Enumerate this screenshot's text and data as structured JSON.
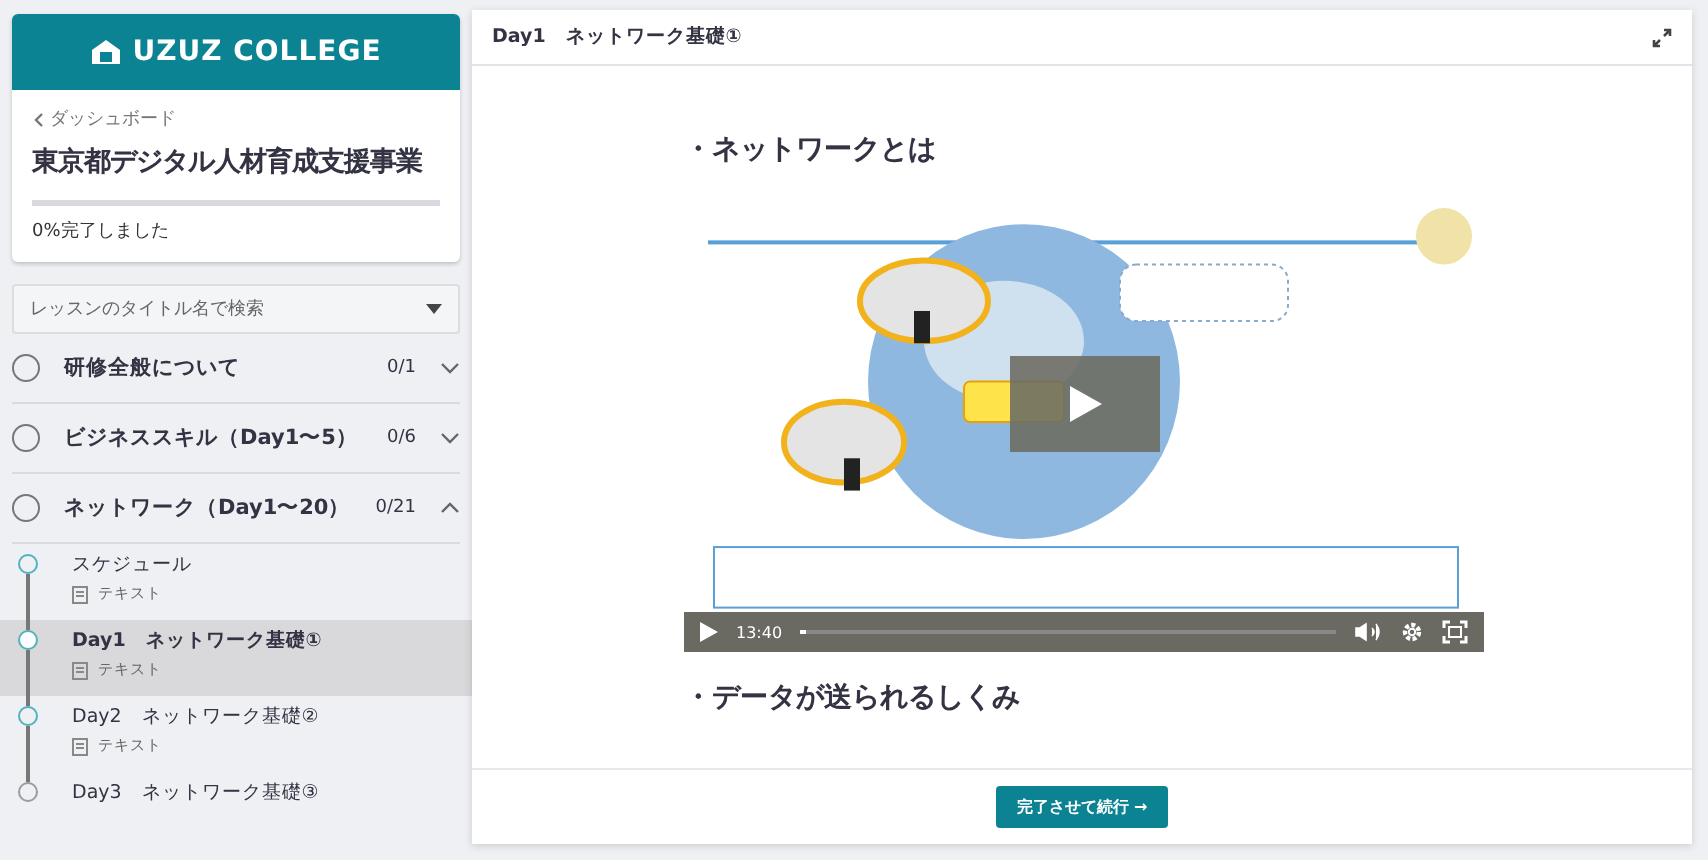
{
  "sidebar": {
    "logo": "UZUZ COLLEGE",
    "back_link": "ダッシュボード",
    "course_title": "東京都デジタル人材育成支援事業",
    "progress": {
      "level": 0,
      "label": "0%完了しました"
    },
    "search": {
      "placeholder": "レッスンのタイトル名で検索"
    },
    "sections": [
      {
        "title": "研修全般について",
        "count": "0/1",
        "expanded": false
      },
      {
        "title": "ビジネススキル（Day1〜5）",
        "count": "0/6",
        "expanded": false
      },
      {
        "title": "ネットワーク（Day1〜20）",
        "count": "0/21",
        "expanded": true,
        "lessons": [
          {
            "title": "スケジュール",
            "type": "テキスト",
            "selected": false,
            "color": "#4fb3bf"
          },
          {
            "title": "Day1　ネットワーク基礎①",
            "type": "テキスト",
            "selected": true,
            "color": "#4fb3bf"
          },
          {
            "title": "Day2　ネットワーク基礎②",
            "type": "テキスト",
            "selected": false,
            "color": "#4fb3bf"
          },
          {
            "title": "Day3　ネットワーク基礎③",
            "selected": false,
            "color": "#9a9aa2"
          }
        ]
      }
    ]
  },
  "lesson": {
    "title": "Day1　ネットワーク基礎①",
    "heading": "・ネットワークとは",
    "video": {
      "kind": "picture",
      "time": "13:40",
      "level": 0.01
    },
    "heading_2": "・データが送られるしくみ",
    "button": "完了させて続行 →"
  }
}
